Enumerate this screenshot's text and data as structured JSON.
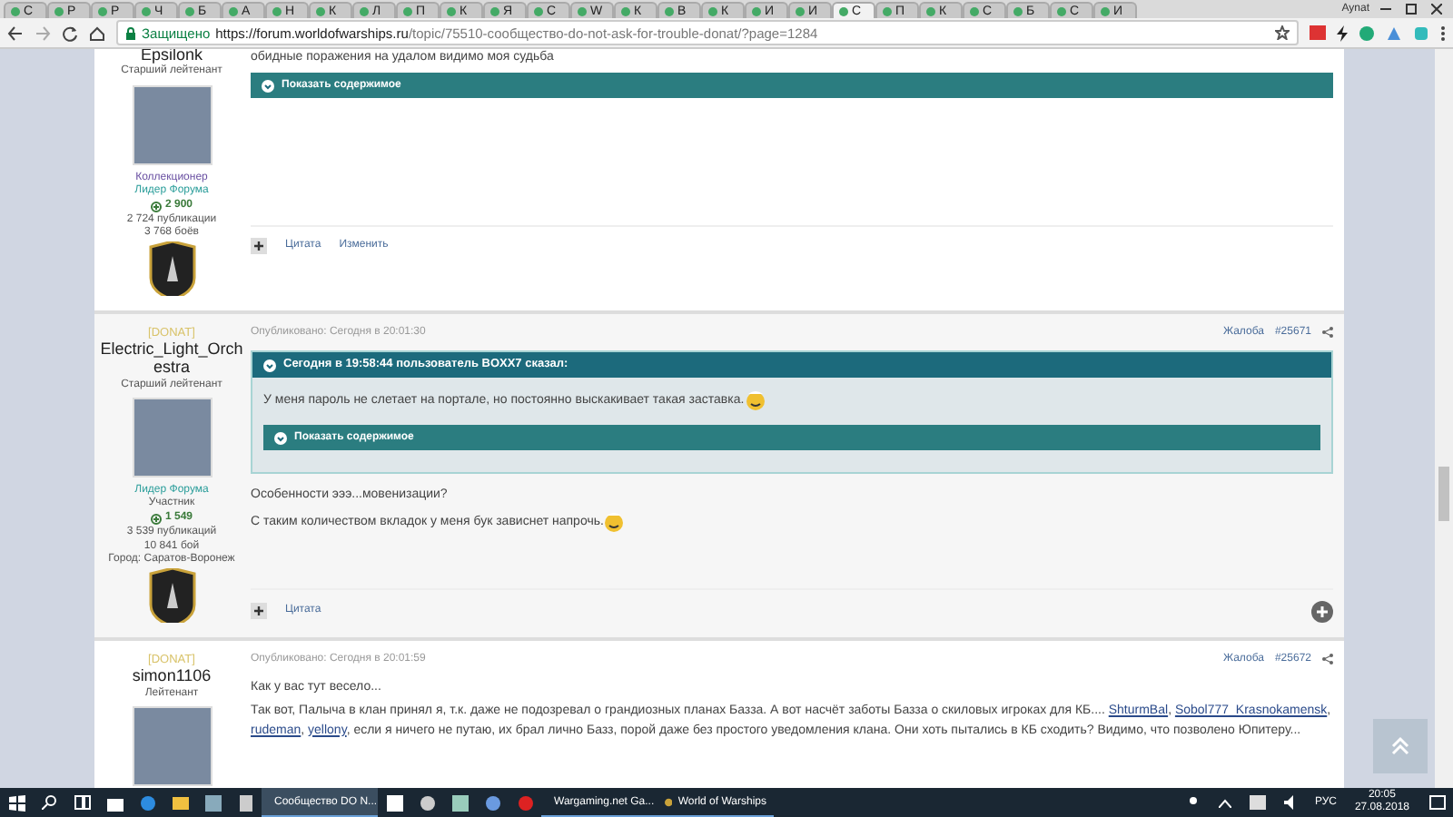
{
  "browser": {
    "tabs": [
      {
        "label": "С",
        "selected": false
      },
      {
        "label": "Р",
        "selected": false
      },
      {
        "label": "Р",
        "selected": false
      },
      {
        "label": "Ч",
        "selected": false
      },
      {
        "label": "Б",
        "selected": false
      },
      {
        "label": "А",
        "selected": false
      },
      {
        "label": "Н",
        "selected": false
      },
      {
        "label": "К",
        "selected": false
      },
      {
        "label": "Л",
        "selected": false
      },
      {
        "label": "П",
        "selected": false
      },
      {
        "label": "К",
        "selected": false
      },
      {
        "label": "Я",
        "selected": false
      },
      {
        "label": "С",
        "selected": false
      },
      {
        "label": "W",
        "selected": false
      },
      {
        "label": "К",
        "selected": false
      },
      {
        "label": "В",
        "selected": false
      },
      {
        "label": "К",
        "selected": false
      },
      {
        "label": "И",
        "selected": false
      },
      {
        "label": "И",
        "selected": false
      },
      {
        "label": "С",
        "selected": true
      },
      {
        "label": "П",
        "selected": false
      },
      {
        "label": "К",
        "selected": false
      },
      {
        "label": "С",
        "selected": false
      },
      {
        "label": "Б",
        "selected": false
      },
      {
        "label": "С",
        "selected": false
      },
      {
        "label": "И",
        "selected": false
      }
    ],
    "user": "Aynat",
    "secure_label": "Защищено",
    "url_host": "https://forum.worldofwarships.ru",
    "url_path": "/topic/75510-сообщество-do-not-ask-for-trouble-donat/?page=1284"
  },
  "posts": [
    {
      "author": {
        "name": "Epsilonk",
        "rank": "Старший лейтенант",
        "roles": [
          {
            "text": "Коллекционер",
            "color": "#6b52a3"
          },
          {
            "text": "Лидер Форума",
            "color": "#2a9d9a"
          }
        ],
        "reputation": "2 900",
        "stats": [
          "2 724 публикации",
          "3 768 боёв"
        ]
      },
      "body": [
        {
          "kind": "text",
          "text": "обидные поражения на удалом видимо моя судьба"
        },
        {
          "kind": "spoiler",
          "text": "Показать содержимое"
        }
      ],
      "actions": [
        "Цитата",
        "Изменить"
      ]
    },
    {
      "author": {
        "group": "[DONAT]",
        "name": "Electric_Light_Orchestra",
        "rank": "Старший лейтенант",
        "roles": [
          {
            "text": "Лидер Форума",
            "color": "#2a9d9a"
          },
          {
            "text": "Участник",
            "color": "#555555"
          }
        ],
        "reputation": "1 549",
        "stats": [
          "3 539 публикаций",
          "10 841 бой",
          "Город: Саратов-Воронеж"
        ]
      },
      "published": "Опубликовано: Сегодня в 20:01:30",
      "report": "Жалоба",
      "number": "#25671",
      "quote": {
        "header": "Сегодня в 19:58:44 пользователь BOXX7 сказал:",
        "text": "У меня пароль не слетает на портале, но постоянно выскакивает такая заставка.",
        "spoiler": "Показать содержимое"
      },
      "body": [
        {
          "kind": "text",
          "text": "Особенности эээ...мовенизации?"
        },
        {
          "kind": "text_emoji",
          "text": "С таким количеством вкладок у меня бук зависнет напрочь."
        }
      ],
      "actions": [
        "Цитата"
      ],
      "add_button": true
    },
    {
      "author": {
        "group": "[DONAT]",
        "name": "simon1106",
        "rank": "Лейтенант"
      },
      "published": "Опубликовано: Сегодня в 20:01:59",
      "report": "Жалоба",
      "number": "#25672",
      "body": [
        {
          "kind": "text",
          "text": "Как у вас тут весело..."
        },
        {
          "kind": "rich",
          "parts": [
            {
              "kind": "text",
              "text": "Так вот, Палыча в клан принял я, т.к. даже не подозревал о грандиозных планах Базза. А вот насчёт заботы Базза о скиловых игроках для КБ.... "
            },
            {
              "kind": "link",
              "text": "ShturmBal"
            },
            {
              "kind": "text",
              "text": ", "
            },
            {
              "kind": "link",
              "text": "Sobol777_Krasnokamensk"
            },
            {
              "kind": "text",
              "text": ", "
            },
            {
              "kind": "link",
              "text": "rudeman"
            },
            {
              "kind": "text",
              "text": ", "
            },
            {
              "kind": "link",
              "text": "yellony"
            },
            {
              "kind": "text",
              "text": ", если я ничего не путаю, их брал лично Базз, порой даже без простого уведомления клана. Они хоть пытались в КБ сходить? Видимо, что позволено Юпитеру..."
            }
          ]
        }
      ]
    }
  ],
  "taskbar": {
    "apps": [
      {
        "label": "Сообщество DO N...",
        "selected": true
      },
      {
        "label": "Wargaming.net Ga...",
        "selected": false
      },
      {
        "label": "World of Warships",
        "selected": false
      }
    ],
    "language": "РУС",
    "time": "20:05",
    "date": "27.08.2018"
  }
}
